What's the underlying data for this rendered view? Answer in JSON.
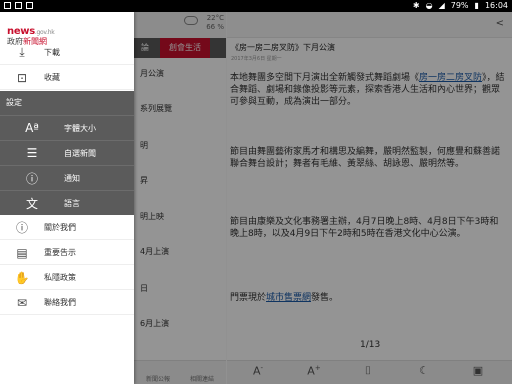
{
  "status": {
    "battery": "79%",
    "time": "16:04"
  },
  "weather": {
    "temp": "22°C",
    "humidity": "66 %"
  },
  "bg_tabs": [
    {
      "label": "論"
    },
    {
      "label": "創會生活"
    }
  ],
  "bg_items": [
    "月公演",
    "系列展覽",
    "明",
    "昇",
    "明上映",
    "4月上演",
    "日",
    "6月上演"
  ],
  "bg_footer": [
    "新聞公報",
    "相關連結"
  ],
  "article": {
    "title": "《房一房二房叉防》下月公演",
    "date": "2017年3月6日 星期一",
    "paragraphs": [
      {
        "pre": "本地舞團多空間下月演出全新觸發式舞蹈劇場《",
        "link": "房一房二房叉防",
        "post": "》，結合舞蹈、劇場和錄像投影等元素，探索香港人生活和內心世界；觀眾可參與互動，成為演出一部分。"
      },
      {
        "text": "節目由舞團藝術家馬才和構思及編舞，嚴明然監製，何應豐和蘇善諾聯合舞台設計；舞者有毛維、黃翠絲、胡詠恩、嚴明然等。"
      },
      {
        "text": "節目由康樂及文化事務署主辦，4月7日晚上8時、4月8日下午3時和晚上8時，以及4月9日下午2時和5時在香港文化中心公演。"
      },
      {
        "pre": "門票現於",
        "link": "城市售票網",
        "post": "發售。"
      }
    ],
    "page": "1/13"
  },
  "drawer": {
    "logo_main": "news",
    "logo_domain": ".gov.hk",
    "logo_sub_a": "政府",
    "logo_sub_b": "新聞網",
    "top_items": [
      {
        "label": "下載",
        "icon": "download-icon"
      },
      {
        "label": "收藏",
        "icon": "bookmark-icon"
      }
    ],
    "settings_header": "設定",
    "settings_items": [
      {
        "label": "字體大小",
        "icon": "font-size-icon"
      },
      {
        "label": "自選新聞",
        "icon": "custom-news-icon"
      },
      {
        "label": "通知",
        "icon": "notification-icon"
      },
      {
        "label": "語言",
        "icon": "language-icon"
      }
    ],
    "bottom_items": [
      {
        "label": "關於我們",
        "icon": "info-icon"
      },
      {
        "label": "重要告示",
        "icon": "notice-icon"
      },
      {
        "label": "私隱政策",
        "icon": "privacy-icon"
      },
      {
        "label": "聯絡我們",
        "icon": "mail-icon"
      }
    ]
  }
}
